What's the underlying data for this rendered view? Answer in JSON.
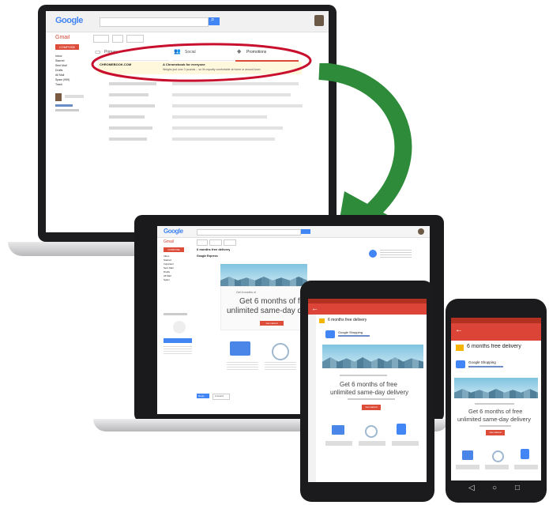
{
  "laptop_back": {
    "logo": "Google",
    "gmail_label": "Gmail",
    "compose_label": "COMPOSE",
    "sidebar_items": [
      "Inbox",
      "Starred",
      "Sent Mail",
      "Drafts",
      "All Mail",
      "Spam (999)",
      "Trash"
    ],
    "tabs": [
      {
        "label": "Primary",
        "icon": "inbox-icon"
      },
      {
        "label": "Social",
        "icon": "people-icon"
      },
      {
        "label": "Promotions",
        "icon": "tag-icon"
      }
    ],
    "promo_email": {
      "sender": "CHROMEBOOK.COM",
      "subject": "A Chromebook for everyone",
      "snippet": "Weighs just over 3 pounds -- so it's equally comfortable at home or around town"
    },
    "highlight_color": "#c8102e"
  },
  "laptop_front": {
    "logo": "Google",
    "gmail_label": "Gmail",
    "compose_label": "COMPOSE",
    "subject": "6 months free delivery",
    "sender": "Google Express",
    "sidebar_items": [
      "Inbox",
      "Starred",
      "Important",
      "Sent Mail",
      "Drafts",
      "All Mail",
      "Spam"
    ],
    "ad_small": "Get 6 months of",
    "ad_headline": "Get 6 months of free",
    "ad_headline2": "unlimited same-day delivery",
    "cta": "Get started",
    "reply_label": "Reply",
    "forward_label": "Forward"
  },
  "tablet": {
    "subject": "6 months free delivery",
    "sender": "Google Shopping",
    "headline": "Get 6 months of free",
    "headline2": "unlimited same-day delivery",
    "cta": "Get started"
  },
  "phone": {
    "subject": "6 months free delivery",
    "sender": "Google Shopping",
    "headline": "Get 6 months of free",
    "headline2": "unlimited same-day delivery",
    "cta": "Get started"
  },
  "colors": {
    "gmail_red": "#db4437",
    "arrow_green": "#2e8b3a",
    "google_blue": "#4285f4"
  }
}
